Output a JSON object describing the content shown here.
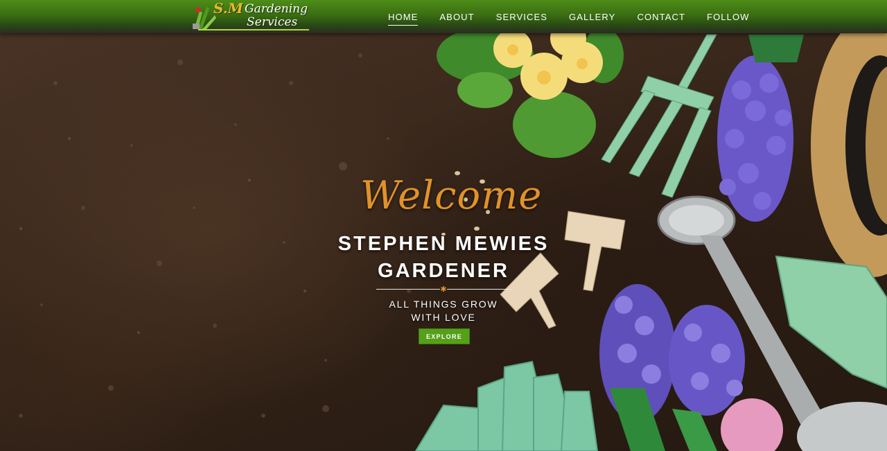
{
  "logo": {
    "initials": "S.M",
    "line1": "Gardening",
    "line2": "Services"
  },
  "nav": {
    "items": [
      {
        "label": "HOME",
        "active": true
      },
      {
        "label": "ABOUT",
        "active": false
      },
      {
        "label": "SERVICES",
        "active": false
      },
      {
        "label": "GALLERY",
        "active": false
      },
      {
        "label": "CONTACT",
        "active": false
      },
      {
        "label": "FOLLOW",
        "active": false
      }
    ]
  },
  "hero": {
    "welcome": "Welcome",
    "name": "STEPHEN MEWIES",
    "role": "GARDENER",
    "tagline_line1": "ALL THINGS GROW",
    "tagline_line2": "WITH LOVE",
    "cta_label": "EXPLORE",
    "divider_icon": "star-icon"
  },
  "colors": {
    "nav_green": "#4e8d18",
    "accent_orange": "#e0922a",
    "button_green": "#55a01a",
    "soil": "#3a281c"
  }
}
